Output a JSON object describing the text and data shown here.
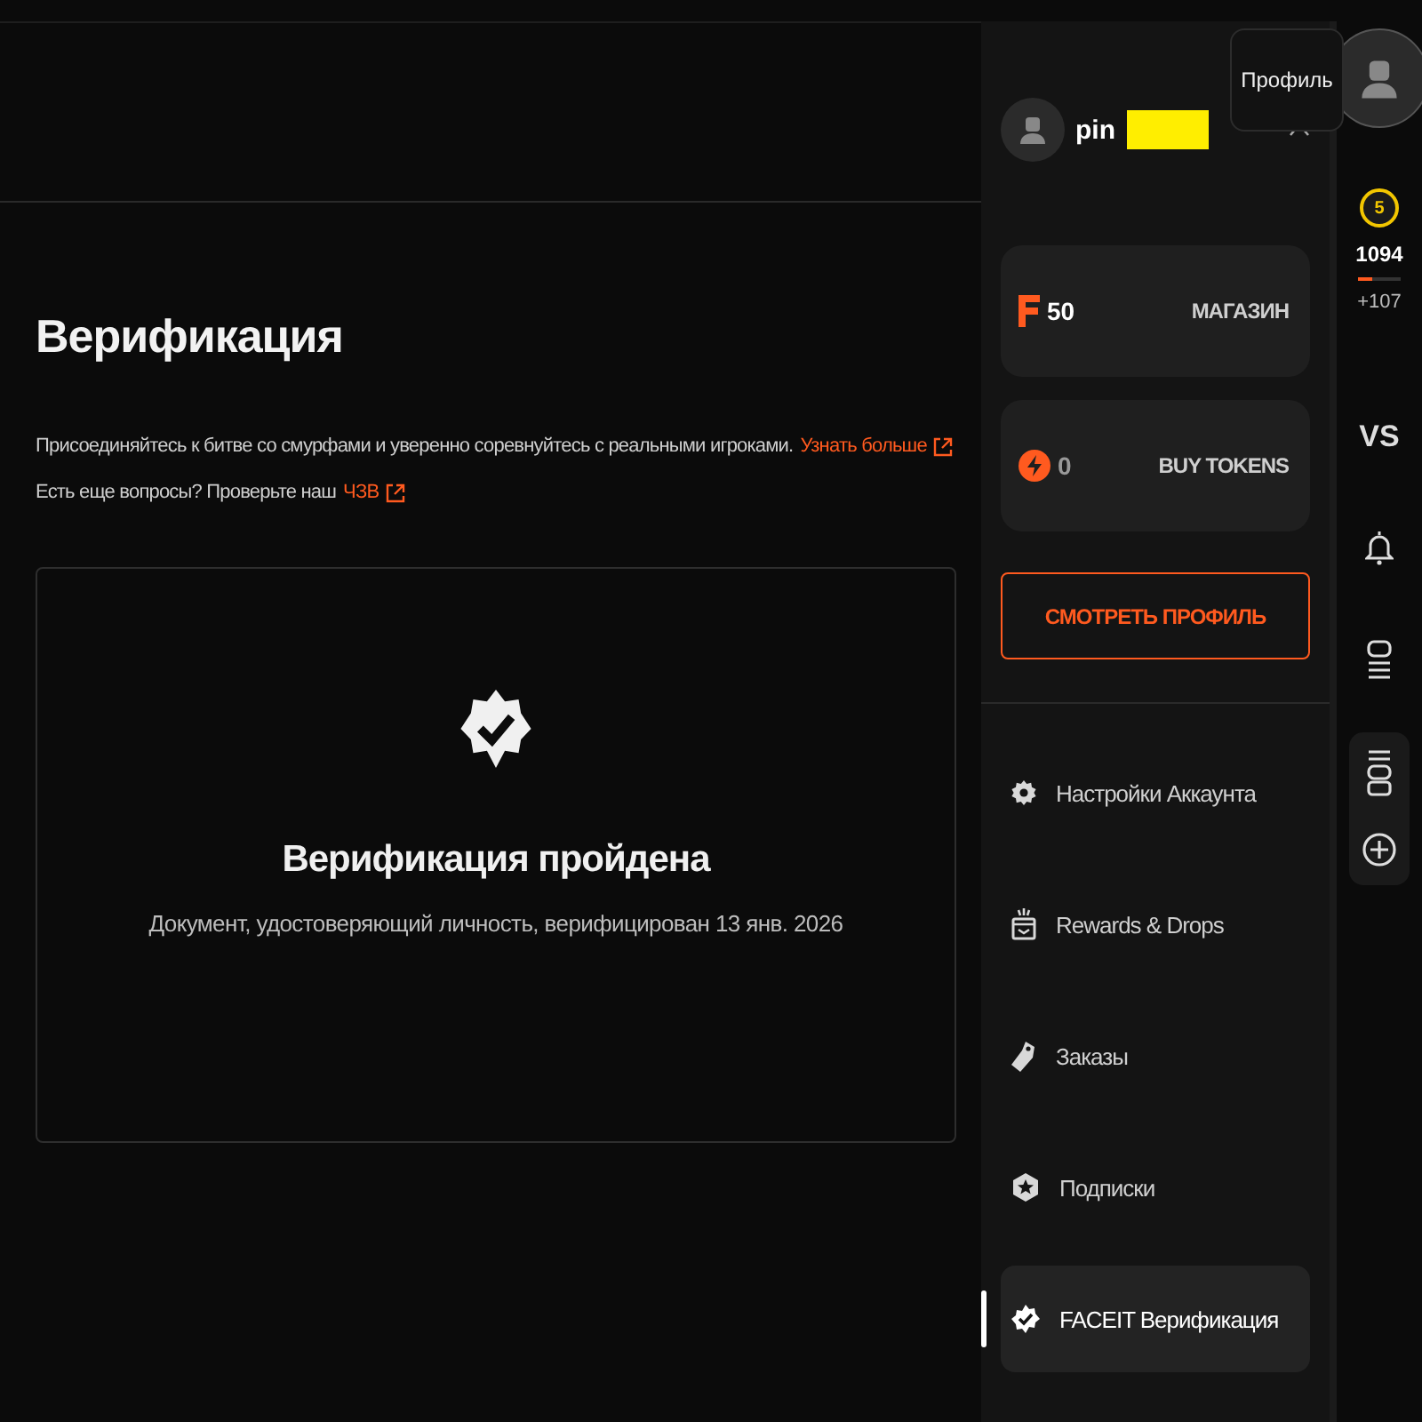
{
  "page": {
    "title": "Верификация",
    "intro": "Присоединяйтесь к битве со смурфами и уверенно соревнуйтесь с реальными игроками.",
    "intro_link": "Узнать больше",
    "faq_text": "Есть еще вопросы? Проверьте наш",
    "faq_link": "ЧЗВ"
  },
  "verification_card": {
    "title": "Верификация пройдена",
    "subtitle": "Документ, удостоверяющий личность, верифицирован 13 янв. 2026"
  },
  "profile_menu": {
    "username": "pin",
    "redacted": true,
    "expanded": true,
    "balances": [
      {
        "kind": "points",
        "amount": "50",
        "action": "МАГАЗИН"
      },
      {
        "kind": "tokens",
        "amount": "0",
        "action": "BUY TOKENS"
      }
    ],
    "view_profile": "СМОТРЕТЬ ПРОФИЛЬ",
    "items": [
      {
        "kind": "settings",
        "label": "Настройки Аккаунта",
        "selected": false
      },
      {
        "kind": "rewards",
        "label": "Rewards & Drops",
        "selected": false
      },
      {
        "kind": "orders",
        "label": "Заказы",
        "selected": false
      },
      {
        "kind": "subscriptions",
        "label": "Подписки",
        "selected": false
      },
      {
        "kind": "verification",
        "label": "FACEIT Верификация",
        "selected": true
      }
    ]
  },
  "tooltip": "Профиль",
  "rail": {
    "level": "5",
    "elo": "1094",
    "elo_progress": {
      "level": 0.35
    },
    "elo_gain": "+107",
    "vs": "VS"
  }
}
